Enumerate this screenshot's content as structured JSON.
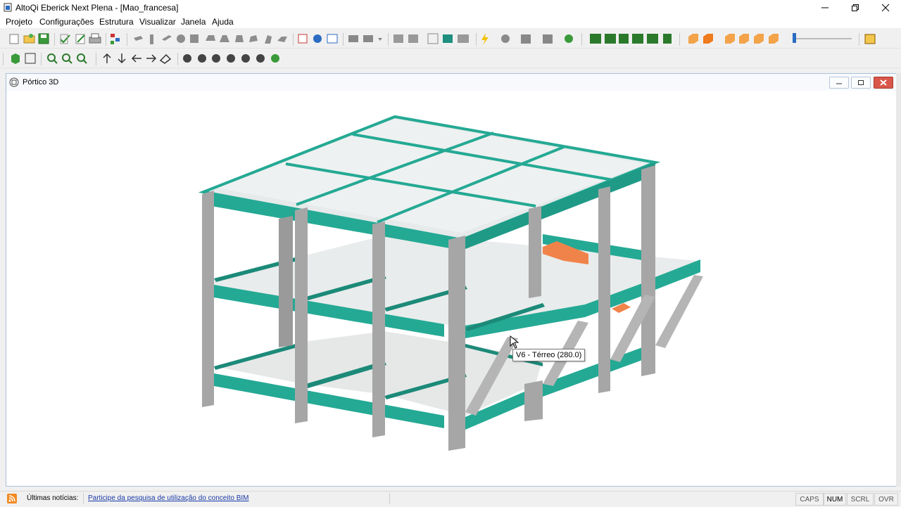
{
  "window": {
    "title": "AltoQi Eberick Next Plena - [Mao_francesa]",
    "app_icon": "eberick-app-icon",
    "controls": [
      "minimize-icon",
      "restore-icon",
      "close-icon"
    ]
  },
  "menubar": {
    "items": [
      "Projeto",
      "Configurações",
      "Estrutura",
      "Visualizar",
      "Janela",
      "Ajuda"
    ]
  },
  "toolbar1": {
    "icons": [
      "new-icon",
      "open-icon",
      "save-icon",
      "check-icon",
      "edit-icon",
      "print-icon",
      "tree-icon",
      "beam-icon",
      "column-icon",
      "slab-icon",
      "round-icon",
      "block-icon",
      "shape-icon",
      "shape2-icon",
      "wall-icon",
      "wall2-icon",
      "panel-icon",
      "panel2-icon",
      "render-icon",
      "view-icon",
      "window-icon",
      "tool-icon",
      "tool2-icon",
      "grid-icon",
      "grid2-icon",
      "report-icon",
      "table-icon",
      "chat-icon",
      "lightning-icon",
      "refresh-icon",
      "settings-icon",
      "image-icon",
      "help-icon",
      "frame-icon",
      "frame2-icon",
      "frame3-icon",
      "frame4-icon",
      "frame5-icon",
      "frame6-icon",
      "cube-icon",
      "cube-orange-icon",
      "cube2-icon",
      "cube3-icon",
      "cube4-icon",
      "cube5-icon",
      "slider-icon",
      "calendar-icon"
    ]
  },
  "toolbar2": {
    "icons": [
      "green-cube-icon",
      "zoom-box-icon",
      "zoom-in-icon",
      "zoom-window-icon",
      "zoom-out-icon",
      "arrow-up-icon",
      "arrow-down-icon",
      "arrow-left-icon",
      "arrow-right-icon",
      "rotate-icon",
      "rotate-x-icon",
      "rotate-y-icon",
      "rotate-z-icon",
      "rotate-xz-icon",
      "rotate-yz-icon",
      "rotate-free-icon"
    ]
  },
  "mdi": {
    "title": "Pórtico 3D",
    "icon": "portico-icon"
  },
  "tooltip": "V6 - Térreo (280.0)",
  "colors": {
    "beam": "#24a994",
    "beam_dark": "#1c8a79",
    "column": "#a6a6a6",
    "slab": "#e4e7e7",
    "stair": "#f0834a"
  },
  "statusbar": {
    "label": "Últimas notícias:",
    "link": "Participe da pesquisa de utilização do conceito BIM",
    "indicators": [
      "CAPS",
      "NUM",
      "SCRL",
      "OVR"
    ]
  }
}
